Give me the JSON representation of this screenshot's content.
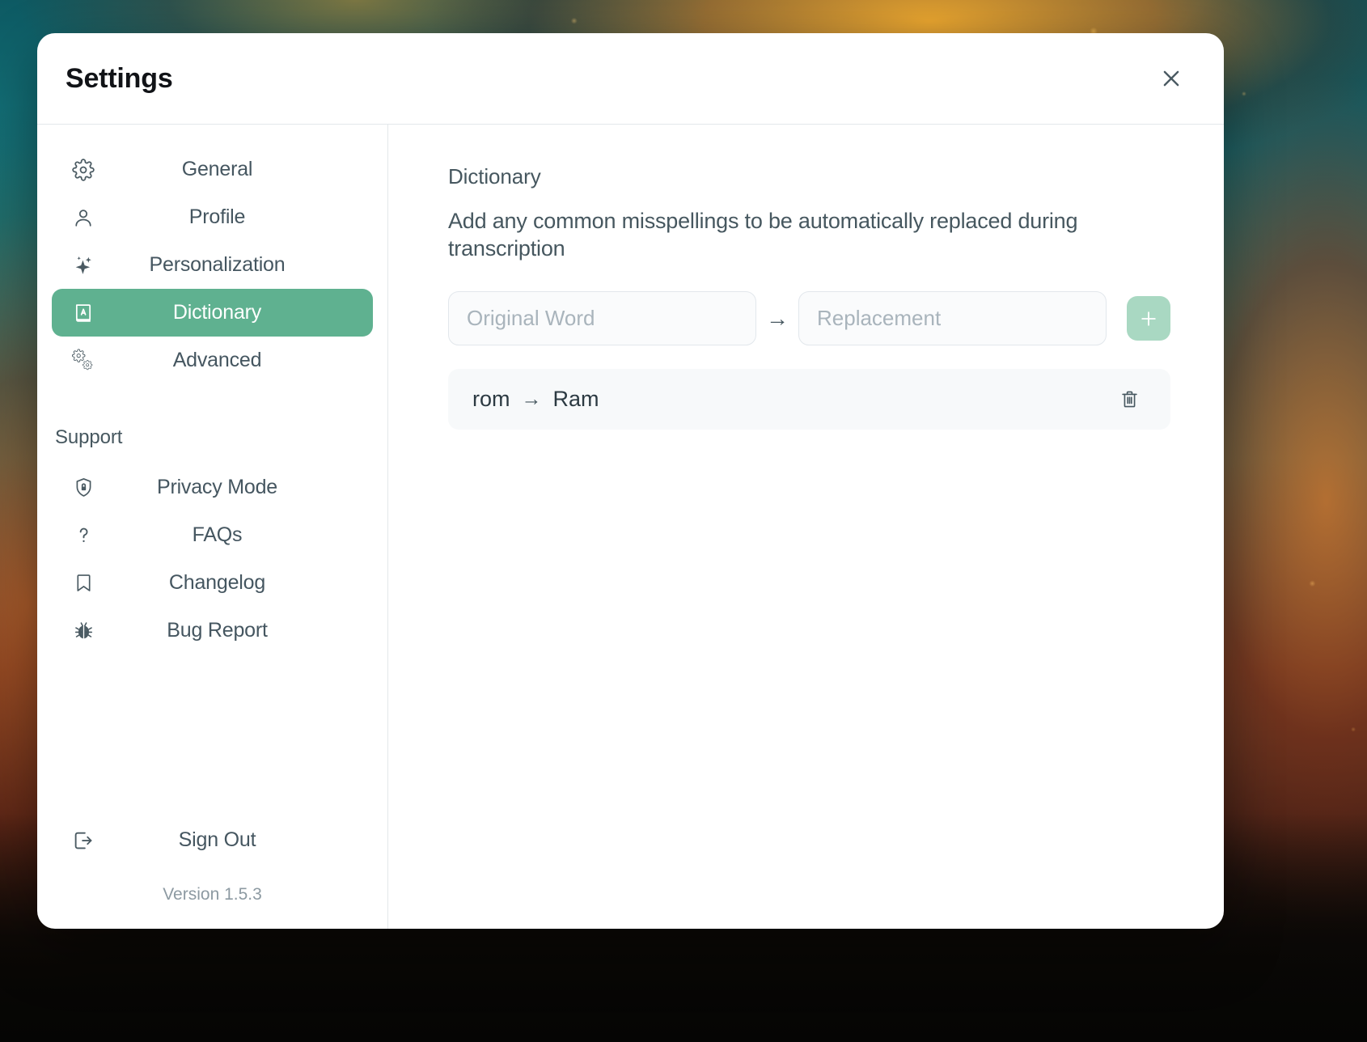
{
  "window": {
    "title": "Settings",
    "close_label": "Close",
    "close_icon": "close-icon"
  },
  "sidebar": {
    "items": [
      {
        "label": "General",
        "icon": "gear-icon",
        "active": false
      },
      {
        "label": "Profile",
        "icon": "user-icon",
        "active": false
      },
      {
        "label": "Personalization",
        "icon": "sparkle-icon",
        "active": false
      },
      {
        "label": "Dictionary",
        "icon": "book-a-icon",
        "active": true
      },
      {
        "label": "Advanced",
        "icon": "gears-icon",
        "active": false
      }
    ],
    "support_heading": "Support",
    "support_items": [
      {
        "label": "Privacy Mode",
        "icon": "shield-lock-icon"
      },
      {
        "label": "FAQs",
        "icon": "question-mark-icon"
      },
      {
        "label": "Changelog",
        "icon": "bookmark-icon"
      },
      {
        "label": "Bug Report",
        "icon": "ladybug-icon"
      }
    ],
    "sign_out": {
      "label": "Sign Out",
      "icon": "sign-out-icon"
    },
    "version": "Version 1.5.3"
  },
  "main": {
    "section_title": "Dictionary",
    "section_description": "Add any common misspellings to be automatically replaced during transcription",
    "form": {
      "original_placeholder": "Original Word",
      "original_value": "",
      "replacement_placeholder": "Replacement",
      "replacement_value": "",
      "arrow": "→",
      "add_button_icon": "plus-icon",
      "add_button_label": "Add"
    },
    "entries": [
      {
        "original": "rom",
        "arrow": "→",
        "replacement": "Ram",
        "delete_icon": "trash-icon"
      }
    ]
  },
  "colors": {
    "accent_green": "#5fb190",
    "add_button_green": "#a9d8c2",
    "text_primary": "#46575f",
    "title_black": "#111317",
    "row_background": "#f7f9fa",
    "input_background": "#fafbfc",
    "border": "#e3e7ea"
  }
}
